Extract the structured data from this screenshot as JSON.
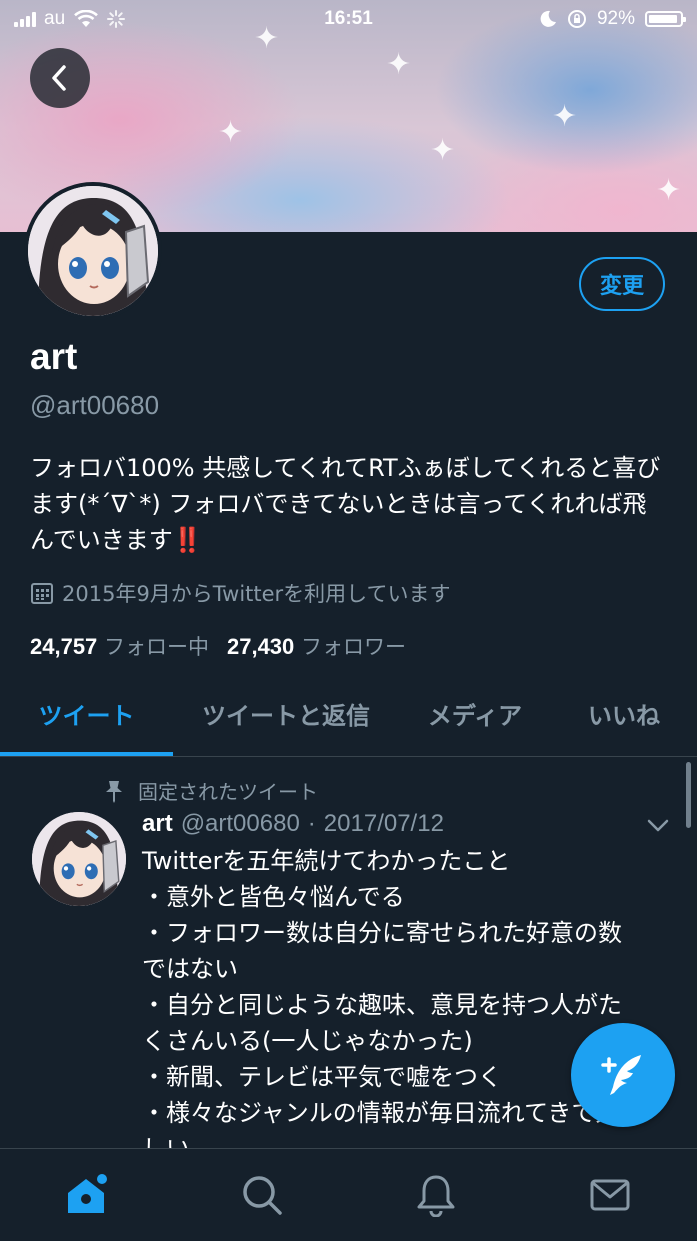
{
  "status_bar": {
    "carrier": "au",
    "time": "16:51",
    "battery": "92%",
    "battery_level": 0.92
  },
  "profile": {
    "edit_label": "変更",
    "name": "art",
    "handle": "@art00680",
    "bio_text": "フォロバ100% 共感してくれてRTふぁぼしてくれると喜びます(*´∇`*) フォロバできてないときは言ってくれれば飛んでいきます",
    "bio_emoji": "‼️",
    "joined": "2015年9月からTwitterを利用しています",
    "following_count": "24,757",
    "following_label": "フォロー中",
    "followers_count": "27,430",
    "followers_label": "フォロワー"
  },
  "tabs": [
    {
      "label": "ツイート",
      "active": true
    },
    {
      "label": "ツイートと返信",
      "active": false
    },
    {
      "label": "メディア",
      "active": false
    },
    {
      "label": "いいね",
      "active": false
    }
  ],
  "tweet": {
    "pinned_label": "固定されたツイート",
    "author_name": "art",
    "author_handle": "@art00680",
    "separator": "·",
    "date": "2017/07/12",
    "lines": [
      "Twitterを五年続けてわかったこと",
      "・意外と皆色々悩んでる",
      "・フォロワー数は自分に寄せられた好意の数",
      "ではない",
      "・自分と同じような趣味、意見を持つ人がた",
      "くさんいる(一人じゃなかった)",
      "・新聞、テレビは平気で嘘をつく",
      "・様々なジャンルの情報が毎日流れてきて楽",
      "しい"
    ]
  },
  "icons": {
    "back": "chevron-left-icon",
    "calendar": "calendar-icon",
    "pin": "pin-icon",
    "compose": "compose-tweet-icon",
    "home": "home-icon",
    "search": "search-icon",
    "notifications": "bell-icon",
    "messages": "mail-icon"
  },
  "colors": {
    "background": "#15202b",
    "accent": "#1da1f2",
    "secondary_text": "#8899a6",
    "divider": "#38444d"
  }
}
